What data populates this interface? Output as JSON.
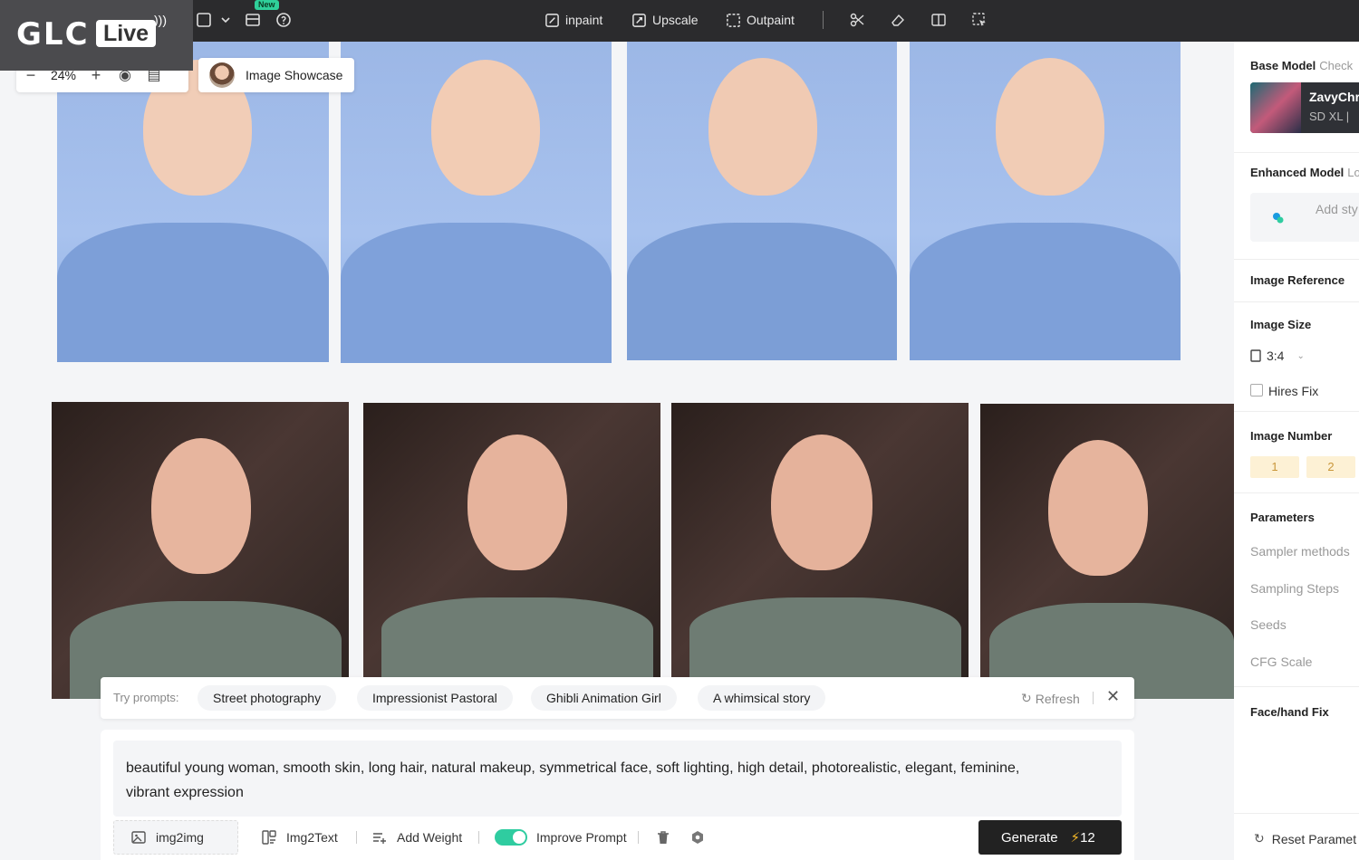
{
  "logo": {
    "glc": "GLC",
    "live": "Live"
  },
  "toolbar": {
    "new_badge": "New",
    "tools": {
      "inpaint": "inpaint",
      "upscale": "Upscale",
      "outpaint": "Outpaint"
    }
  },
  "canvas": {
    "zoom": "24%",
    "showcase": "Image Showcase"
  },
  "right_panel": {
    "base_model": {
      "title": "Base Model",
      "sub": "Check",
      "name": "ZavyChr",
      "tag": "SD XL  |"
    },
    "enhanced_model": {
      "title": "Enhanced Model",
      "sub": "Lo",
      "add": "Add sty"
    },
    "image_reference": "Image Reference",
    "image_size": {
      "title": "Image Size",
      "value": "3:4"
    },
    "hires_fix": "Hires Fix",
    "image_number": {
      "title": "Image Number",
      "options": [
        "1",
        "2"
      ]
    },
    "parameters": {
      "title": "Parameters",
      "items": [
        "Sampler methods",
        "Sampling Steps",
        "Seeds",
        "CFG Scale"
      ]
    },
    "face_hand_fix": "Face/hand Fix",
    "reset": "Reset Paramet"
  },
  "prompts": {
    "try_label": "Try prompts:",
    "chips": [
      "Street photography",
      "Impressionist Pastoral",
      "Ghibli Animation Girl",
      "A whimsical story"
    ],
    "refresh": "Refresh"
  },
  "composer": {
    "prompt_line1": "beautiful young woman, smooth skin, long hair, natural makeup, symmetrical face, soft lighting, high detail, photorealistic, elegant, feminine,",
    "prompt_line2": "vibrant expression",
    "img2img": "img2img",
    "img2text": "Img2Text",
    "add_weight": "Add Weight",
    "improve_prompt": "Improve Prompt",
    "generate": "Generate",
    "cost": "12"
  },
  "colors": {
    "accent": "#2fcca0",
    "toolbar_bg": "#2b2b2d",
    "generate_bg": "#222222",
    "number_bg": "#fdf1d5"
  }
}
